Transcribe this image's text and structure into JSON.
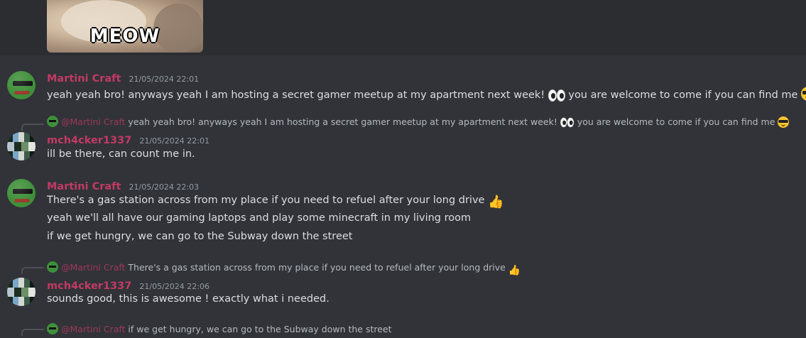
{
  "gif": {
    "caption": "MEOW"
  },
  "colors": {
    "username": "#c23a63",
    "background": "#313338",
    "text": "#dbdee1",
    "timestamp": "#949ba4"
  },
  "messages": [
    {
      "author": "Martini Craft",
      "time": "21/05/2024 22:01",
      "lines": [
        "yeah yeah bro! anyways yeah I am hosting a secret gamer meetup at my apartment next week!",
        "you are welcome to come if you can find me"
      ]
    },
    {
      "reply_to": {
        "mention": "@Martini Craft",
        "text_a": "yeah yeah bro! anyways yeah I am hosting a secret gamer meetup at my apartment next week!",
        "text_b": "you are welcome to come if you can find me"
      },
      "author": "mch4cker1337",
      "time": "21/05/2024 22:01",
      "lines": [
        "ill be there, can count me in."
      ]
    },
    {
      "author": "Martini Craft",
      "time": "21/05/2024 22:03",
      "lines": [
        "There's a gas station across from my place if you need to refuel after your long drive",
        "yeah we'll all have our gaming laptops and play some minecraft in my living room",
        "if we get hungry, we can go to the Subway down the street"
      ]
    },
    {
      "reply_to": {
        "mention": "@Martini Craft",
        "text": "There's a gas station across from my place if you need to refuel after your long drive"
      },
      "author": "mch4cker1337",
      "time": "21/05/2024 22:06",
      "lines": [
        "sounds good, this is awesome ! exactly what i needed."
      ]
    },
    {
      "reply_to": {
        "mention": "@Martini Craft",
        "text": "if we get hungry, we can go to the Subway down the street"
      }
    }
  ],
  "icons": [
    "eyes-emoji",
    "sunglasses-emoji",
    "thumbs-up-emoji"
  ]
}
